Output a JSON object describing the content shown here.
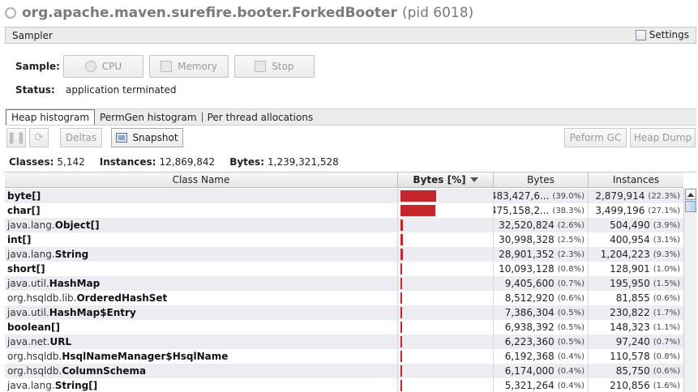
{
  "title": {
    "main": "org.apache.maven.surefire.booter.ForkedBooter",
    "pid": "(pid 6018)"
  },
  "sampler": {
    "label": "Sampler",
    "settings_label": "Settings"
  },
  "sample": {
    "label": "Sample:",
    "buttons": [
      "CPU",
      "Memory",
      "Stop"
    ]
  },
  "status": {
    "label": "Status:",
    "value": "application terminated"
  },
  "tabs": [
    "Heap histogram",
    "PermGen histogram",
    "Per thread allocations"
  ],
  "toolbar": {
    "deltas": "Deltas",
    "snapshot": "Snapshot",
    "gc": "Peform GC",
    "heap_dump": "Heap Dump"
  },
  "summary": {
    "classes_label": "Classes:",
    "classes": "5,142",
    "instances_label": "Instances:",
    "instances": "12,869,842",
    "bytes_label": "Bytes:",
    "bytes": "1,239,321,528"
  },
  "columns": [
    "Class Name",
    "Bytes [%]",
    "Bytes",
    "Instances"
  ],
  "rows": [
    {
      "pkg": "",
      "cls": "byte[]",
      "bar": 0.39,
      "bytes": "483,427,6...",
      "bytes_pct": "(39.0%)",
      "instances": "2,879,914",
      "inst_pct": "(22.3%)"
    },
    {
      "pkg": "",
      "cls": "char[]",
      "bar": 0.383,
      "bytes": "475,158,2...",
      "bytes_pct": "(38.3%)",
      "instances": "3,499,196",
      "inst_pct": "(27.1%)"
    },
    {
      "pkg": "java.lang.",
      "cls": "Object[]",
      "bar": 0.026,
      "bytes": "32,520,824",
      "bytes_pct": "(2.6%)",
      "instances": "504,490",
      "inst_pct": "(3.9%)"
    },
    {
      "pkg": "",
      "cls": "int[]",
      "bar": 0.025,
      "bytes": "30,998,328",
      "bytes_pct": "(2.5%)",
      "instances": "400,954",
      "inst_pct": "(3.1%)"
    },
    {
      "pkg": "java.lang.",
      "cls": "String",
      "bar": 0.023,
      "bytes": "28,901,352",
      "bytes_pct": "(2.3%)",
      "instances": "1,204,223",
      "inst_pct": "(9.3%)"
    },
    {
      "pkg": "",
      "cls": "short[]",
      "bar": 0.008,
      "bytes": "10,093,128",
      "bytes_pct": "(0.8%)",
      "instances": "128,901",
      "inst_pct": "(1.0%)"
    },
    {
      "pkg": "java.util.",
      "cls": "HashMap",
      "bar": 0.007,
      "bytes": "9,405,600",
      "bytes_pct": "(0.7%)",
      "instances": "195,950",
      "inst_pct": "(1.5%)"
    },
    {
      "pkg": "org.hsqldb.lib.",
      "cls": "OrderedHashSet",
      "bar": 0.006,
      "bytes": "8,512,920",
      "bytes_pct": "(0.6%)",
      "instances": "81,855",
      "inst_pct": "(0.6%)"
    },
    {
      "pkg": "java.util.",
      "cls": "HashMap$Entry",
      "bar": 0.005,
      "bytes": "7,386,304",
      "bytes_pct": "(0.5%)",
      "instances": "230,822",
      "inst_pct": "(1.7%)"
    },
    {
      "pkg": "",
      "cls": "boolean[]",
      "bar": 0.005,
      "bytes": "6,938,392",
      "bytes_pct": "(0.5%)",
      "instances": "148,323",
      "inst_pct": "(1.1%)"
    },
    {
      "pkg": "java.net.",
      "cls": "URL",
      "bar": 0.005,
      "bytes": "6,223,360",
      "bytes_pct": "(0.5%)",
      "instances": "97,240",
      "inst_pct": "(0.7%)"
    },
    {
      "pkg": "org.hsqldb.",
      "cls": "HsqlNameManager$HsqlName",
      "bar": 0.004,
      "bytes": "6,192,368",
      "bytes_pct": "(0.4%)",
      "instances": "110,578",
      "inst_pct": "(0.8%)"
    },
    {
      "pkg": "org.hsqldb.",
      "cls": "ColumnSchema",
      "bar": 0.004,
      "bytes": "6,174,000",
      "bytes_pct": "(0.4%)",
      "instances": "85,750",
      "inst_pct": "(0.6%)"
    },
    {
      "pkg": "java.lang.",
      "cls": "String[]",
      "bar": 0.004,
      "bytes": "5,321,264",
      "bytes_pct": "(0.4%)",
      "instances": "210,856",
      "inst_pct": "(1.6%)"
    }
  ],
  "colors": {
    "bar": "#c3272b",
    "row_alt": "#ececf2"
  }
}
